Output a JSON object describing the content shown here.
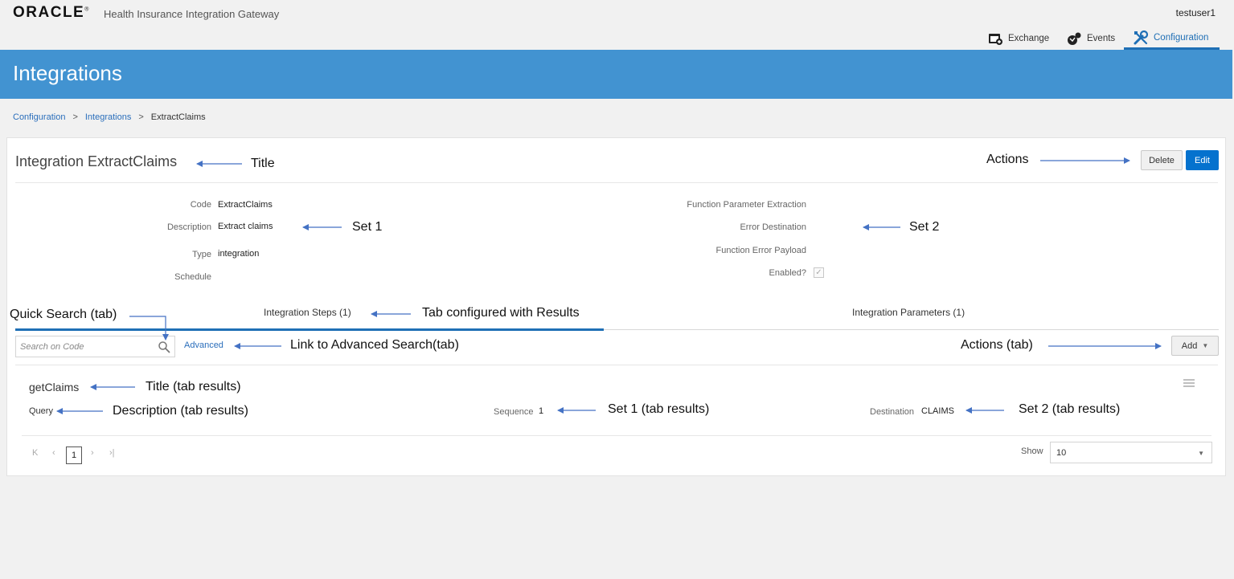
{
  "header": {
    "brand": "ORACLE",
    "brand_mark": "®",
    "product": "Health Insurance Integration Gateway",
    "user": "testuser1",
    "nav": [
      {
        "label": "Exchange",
        "icon": "exchange-icon"
      },
      {
        "label": "Events",
        "icon": "events-icon"
      },
      {
        "label": "Configuration",
        "icon": "configuration-icon",
        "active": true
      }
    ],
    "accent_color": "#1f6fb5"
  },
  "banner": {
    "title": "Integrations",
    "color": "#4293d1"
  },
  "breadcrumb": {
    "items": [
      "Configuration",
      "Integrations",
      "ExtractClaims"
    ],
    "separator": ">"
  },
  "detail": {
    "title": "Integration ExtractClaims",
    "actions": {
      "delete": "Delete",
      "edit": "Edit"
    },
    "set1": [
      {
        "label": "Code",
        "value": "ExtractClaims"
      },
      {
        "label": "Description",
        "value": "Extract claims"
      },
      {
        "label": "Type",
        "value": "integration"
      },
      {
        "label": "Schedule",
        "value": ""
      }
    ],
    "set2": [
      {
        "label": "Function Parameter Extraction",
        "value": ""
      },
      {
        "label": "Error Destination",
        "value": ""
      },
      {
        "label": "Function Error Payload",
        "value": ""
      },
      {
        "label": "Enabled?",
        "value": "✓"
      }
    ]
  },
  "tabs": [
    {
      "label": "Integration Steps (1)",
      "active": true
    },
    {
      "label": "Integration Parameters (1)",
      "active": false
    }
  ],
  "tab_toolbar": {
    "search_placeholder": "Search on Code",
    "advanced_link": "Advanced",
    "add_button": "Add",
    "add_caret": "▼"
  },
  "results": [
    {
      "title": "getClaims",
      "description": "Query",
      "set1": {
        "label": "Sequence",
        "value": "1"
      },
      "set2": {
        "label": "Destination",
        "value": "CLAIMS"
      }
    }
  ],
  "pagination": {
    "first": "K",
    "prev": "‹",
    "current_page": "1",
    "next": "›",
    "last": "›|",
    "show_label": "Show",
    "page_size": "10",
    "select_caret": "▼"
  },
  "annotations": {
    "title": "Title",
    "actions": "Actions",
    "set1": "Set 1",
    "set2": "Set 2",
    "quick_search": "Quick Search (tab)",
    "tab_configured": "Tab configured with Results",
    "advanced_link": "Link to Advanced Search(tab)",
    "actions_tab": "Actions (tab)",
    "title_results": "Title (tab results)",
    "desc_results": "Description (tab results)",
    "set1_results": "Set 1 (tab results)",
    "set2_results": "Set 2 (tab results)"
  }
}
